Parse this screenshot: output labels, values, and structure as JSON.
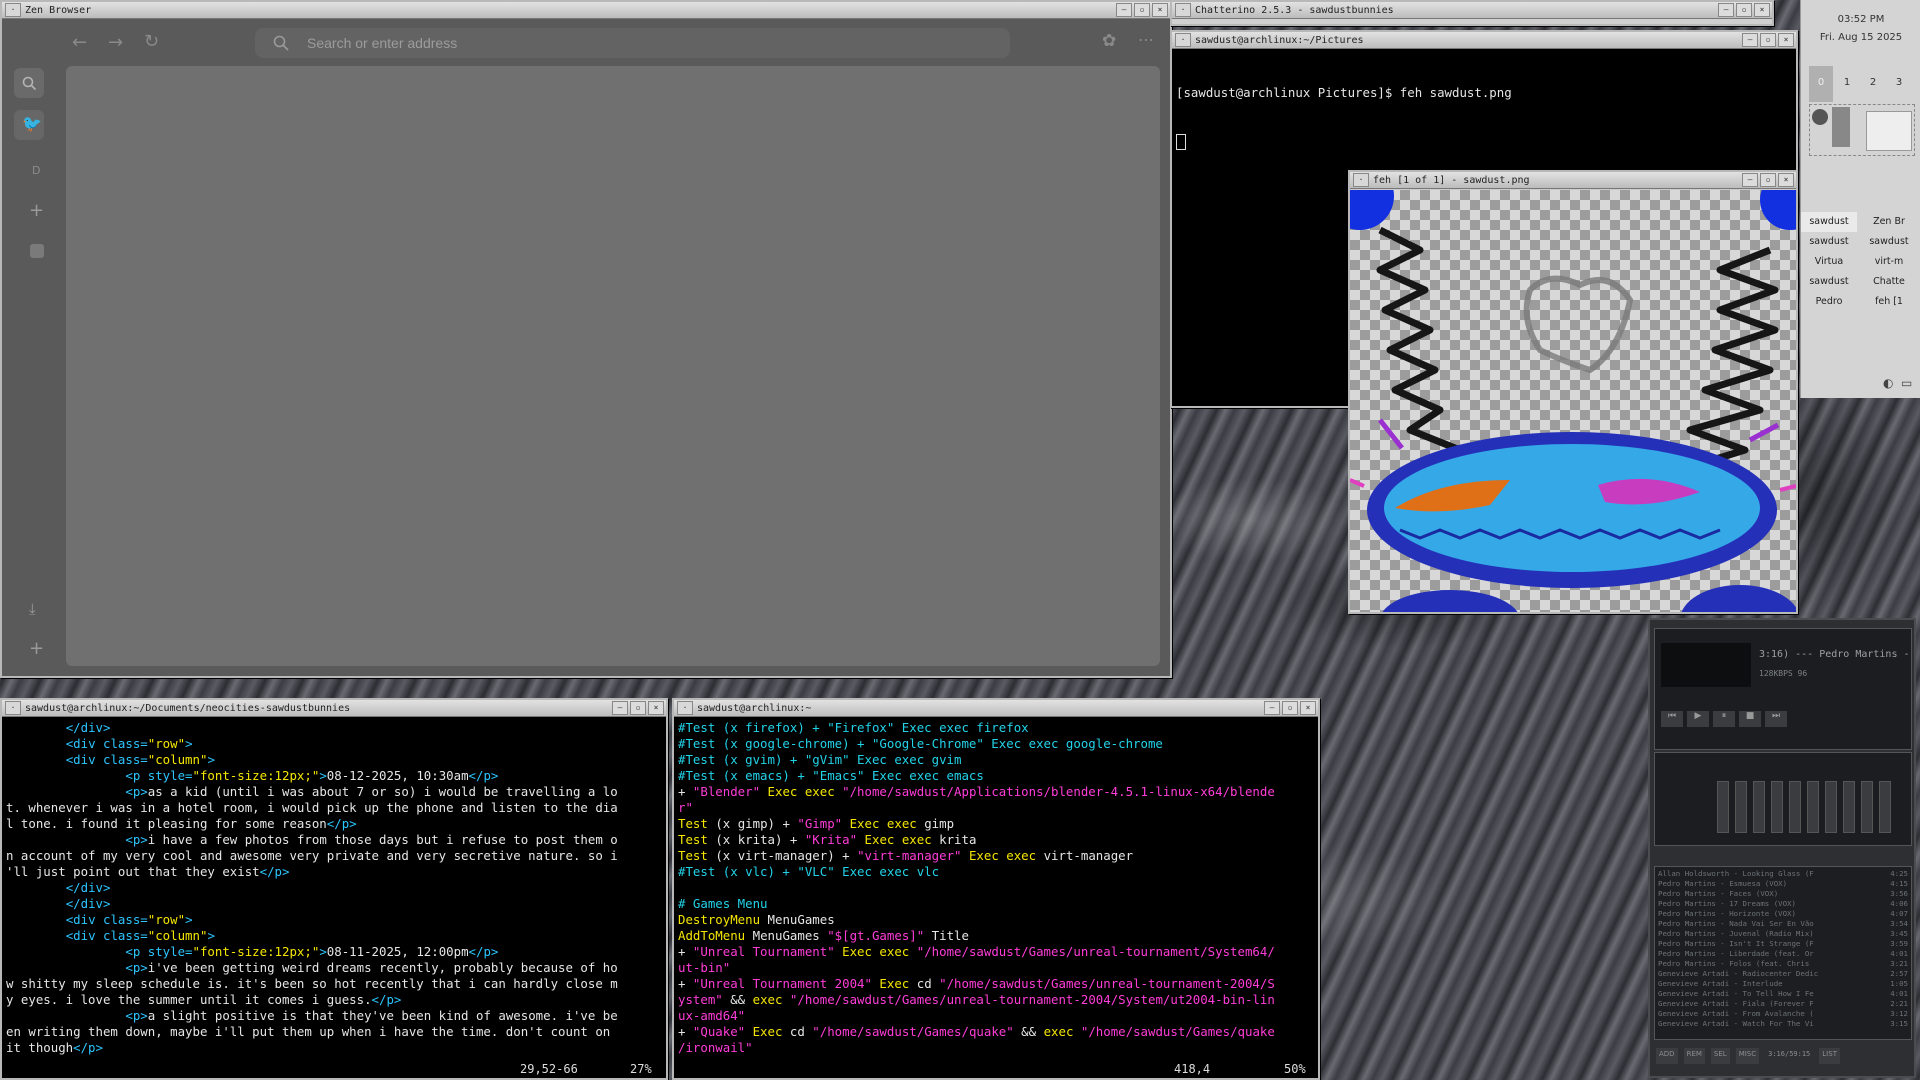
{
  "browser": {
    "title": "Zen Browser",
    "url_placeholder": "Search or enter address",
    "sidebar_letter": "D"
  },
  "chatterino": {
    "title": "Chatterino 2.5.3 - sawdustbunnies"
  },
  "term_top": {
    "title": "sawdust@archlinux:~/Pictures",
    "prompt": "[sawdust@archlinux Pictures]$ feh sawdust.png"
  },
  "feh": {
    "title": "feh [1 of 1] - sawdust.png"
  },
  "clock": {
    "time": "03:52 PM",
    "date": "Fri. Aug 15 2025"
  },
  "pager": {
    "workspaces": [
      "0",
      "1",
      "2",
      "3"
    ]
  },
  "tasklist": [
    {
      "a": "sawdust",
      "b": "Zen Br"
    },
    {
      "a": "sawdust",
      "b": "sawdust"
    },
    {
      "a": "Virtua",
      "b": "virt-m"
    },
    {
      "a": "sawdust",
      "b": "Chatte"
    },
    {
      "a": "Pedro",
      "b": "feh [1"
    }
  ],
  "vim_left": {
    "title": "sawdust@archlinux:~/Documents/neocities-sawdustbunnies",
    "lines": [
      {
        "i": "        ",
        "t": [
          [
            "b",
            "</div>"
          ]
        ]
      },
      {
        "i": "        ",
        "t": [
          [
            "b",
            "<div class="
          ],
          [
            "y",
            "\"row\""
          ],
          [
            "b",
            ">"
          ]
        ]
      },
      {
        "i": "        ",
        "t": [
          [
            "b",
            "<div class="
          ],
          [
            "y",
            "\"column\""
          ],
          [
            "b",
            ">"
          ]
        ]
      },
      {
        "i": "                ",
        "t": [
          [
            "b",
            "<p style="
          ],
          [
            "y",
            "\"font-size:12px;\""
          ],
          [
            "b",
            ">"
          ],
          [
            "w",
            "08-12-2025, 10:30am"
          ],
          [
            "b",
            "</p>"
          ]
        ]
      },
      {
        "i": "                ",
        "t": [
          [
            "b",
            "<p>"
          ],
          [
            "w",
            "as a kid (until i was about 7 or so) i would be travelling a lo"
          ]
        ]
      },
      {
        "i": "",
        "t": [
          [
            "w",
            "t. whenever i was in a hotel room, i would pick up the phone and listen to the dia"
          ]
        ]
      },
      {
        "i": "",
        "t": [
          [
            "w",
            "l tone. i found it pleasing for some reason"
          ],
          [
            "b",
            "</p>"
          ]
        ]
      },
      {
        "i": "                ",
        "t": [
          [
            "b",
            "<p>"
          ],
          [
            "w",
            "i have a few photos from those days but i refuse to post them o"
          ]
        ]
      },
      {
        "i": "",
        "t": [
          [
            "w",
            "n account of my very cool and awesome very private and very secretive nature. so i"
          ]
        ]
      },
      {
        "i": "",
        "t": [
          [
            "w",
            "'ll just point out that they exist"
          ],
          [
            "b",
            "</p>"
          ]
        ]
      },
      {
        "i": "        ",
        "t": [
          [
            "b",
            "</div>"
          ]
        ]
      },
      {
        "i": "        ",
        "t": [
          [
            "b",
            "</div>"
          ]
        ]
      },
      {
        "i": "        ",
        "t": [
          [
            "b",
            "<div class="
          ],
          [
            "y",
            "\"row\""
          ],
          [
            "b",
            ">"
          ]
        ]
      },
      {
        "i": "        ",
        "t": [
          [
            "b",
            "<div class="
          ],
          [
            "y",
            "\"column\""
          ],
          [
            "b",
            ">"
          ]
        ]
      },
      {
        "i": "                ",
        "t": [
          [
            "b",
            "<p style="
          ],
          [
            "y",
            "\"font-size:12px;\""
          ],
          [
            "b",
            ">"
          ],
          [
            "w",
            "08-11-2025, 12:00pm"
          ],
          [
            "b",
            "</p>"
          ]
        ]
      },
      {
        "i": "                ",
        "t": [
          [
            "b",
            "<p>"
          ],
          [
            "w",
            "i've been getting weird dreams recently, probably because of ho"
          ]
        ]
      },
      {
        "i": "",
        "t": [
          [
            "w",
            "w shitty my sleep schedule is. it's been so hot recently that i can hardly close m"
          ]
        ]
      },
      {
        "i": "",
        "t": [
          [
            "w",
            "y eyes. i love the summer until it comes i guess."
          ],
          [
            "b",
            "</p>"
          ]
        ]
      },
      {
        "i": "                ",
        "t": [
          [
            "b",
            "<p>"
          ],
          [
            "w",
            "a slight positive is that they've been kind of awesome. i've be"
          ]
        ]
      },
      {
        "i": "",
        "t": [
          [
            "w",
            "en writing them down, maybe i'll put them up when i have the time. don't count on"
          ]
        ]
      },
      {
        "i": "",
        "t": [
          [
            "w",
            "it though"
          ],
          [
            "b",
            "</p>"
          ]
        ]
      }
    ],
    "pos": "29,52-66",
    "pct": "27%"
  },
  "vim_right": {
    "title": "sawdust@archlinux:~",
    "lines": [
      {
        "t": [
          [
            "c",
            "#Test (x firefox) + \"Firefox\" Exec exec firefox"
          ]
        ]
      },
      {
        "t": [
          [
            "c",
            "#Test (x google-chrome) + \"Google-Chrome\" Exec exec google-chrome"
          ]
        ]
      },
      {
        "t": [
          [
            "c",
            "#Test (x gvim) + \"gVim\" Exec exec gvim"
          ]
        ]
      },
      {
        "t": [
          [
            "c",
            "#Test (x emacs) + \"Emacs\" Exec exec emacs"
          ]
        ]
      },
      {
        "t": [
          [
            "w",
            "+ "
          ],
          [
            "m",
            "\"Blender\""
          ],
          [
            "y",
            " Exec exec "
          ],
          [
            "m",
            "\"/home/sawdust/Applications/blender-4.5.1-linux-x64/blende"
          ]
        ]
      },
      {
        "t": [
          [
            "m",
            "r\""
          ]
        ]
      },
      {
        "t": [
          [
            "y",
            "Test "
          ],
          [
            "w",
            "(x gimp) + "
          ],
          [
            "m",
            "\"Gimp\""
          ],
          [
            "y",
            " Exec exec "
          ],
          [
            "w",
            "gimp"
          ]
        ]
      },
      {
        "t": [
          [
            "y",
            "Test "
          ],
          [
            "w",
            "(x krita) + "
          ],
          [
            "m",
            "\"Krita\""
          ],
          [
            "y",
            " Exec exec "
          ],
          [
            "w",
            "krita"
          ]
        ]
      },
      {
        "t": [
          [
            "y",
            "Test "
          ],
          [
            "w",
            "(x virt-manager) + "
          ],
          [
            "m",
            "\"virt-manager\""
          ],
          [
            "y",
            " Exec exec "
          ],
          [
            "w",
            "virt-manager"
          ]
        ]
      },
      {
        "t": [
          [
            "c",
            "#Test (x vlc) + \"VLC\" Exec exec vlc"
          ]
        ]
      },
      {
        "t": [
          [
            "w",
            ""
          ]
        ]
      },
      {
        "t": [
          [
            "c",
            "# Games Menu"
          ]
        ]
      },
      {
        "t": [
          [
            "y",
            "DestroyMenu "
          ],
          [
            "w",
            "MenuGames"
          ]
        ]
      },
      {
        "t": [
          [
            "y",
            "AddToMenu "
          ],
          [
            "w",
            "MenuGames "
          ],
          [
            "m",
            "\"$[gt.Games]\""
          ],
          [
            "w",
            " Title"
          ]
        ]
      },
      {
        "t": [
          [
            "w",
            "+ "
          ],
          [
            "m",
            "\"Unreal Tournament\""
          ],
          [
            "y",
            " Exec exec "
          ],
          [
            "m",
            "\"/home/sawdust/Games/unreal-tournament/System64/"
          ]
        ]
      },
      {
        "t": [
          [
            "m",
            "ut-bin\""
          ]
        ]
      },
      {
        "t": [
          [
            "w",
            "+ "
          ],
          [
            "m",
            "\"Unreal Tournament 2004\""
          ],
          [
            "y",
            " Exec "
          ],
          [
            "w",
            "cd "
          ],
          [
            "m",
            "\"/home/sawdust/Games/unreal-tournament-2004/S"
          ]
        ]
      },
      {
        "t": [
          [
            "m",
            "ystem\""
          ],
          [
            "w",
            " && "
          ],
          [
            "y",
            "exec "
          ],
          [
            "m",
            "\"/home/sawdust/Games/unreal-tournament-2004/System/ut2004-bin-lin"
          ]
        ]
      },
      {
        "t": [
          [
            "m",
            "ux-amd64\""
          ]
        ]
      },
      {
        "t": [
          [
            "w",
            "+ "
          ],
          [
            "m",
            "\"Quake\""
          ],
          [
            "y",
            " Exec "
          ],
          [
            "w",
            "cd "
          ],
          [
            "m",
            "\"/home/sawdust/Games/quake\""
          ],
          [
            "w",
            " && "
          ],
          [
            "y",
            "exec "
          ],
          [
            "m",
            "\"/home/sawdust/Games/quake"
          ]
        ]
      },
      {
        "t": [
          [
            "m",
            "/ironwail\""
          ]
        ]
      }
    ],
    "pos": "418,4",
    "pct": "50%"
  },
  "winamp": {
    "track": "3:16) --- Pedro Martins -",
    "bitrate": "128KBPS 96",
    "playlist": [
      {
        "title": "Allan Holdsworth - Looking Glass (F",
        "len": "4:25"
      },
      {
        "title": "Pedro Martins - Esmuesa (VOX)",
        "len": "4:15"
      },
      {
        "title": "Pedro Martins - Faces (VOX)",
        "len": "3:56"
      },
      {
        "title": "Pedro Martins - 17 Dreams (VOX)",
        "len": "4:06"
      },
      {
        "title": "Pedro Martins - Horizonte (VOX)",
        "len": "4:07"
      },
      {
        "title": "Pedro Martins - Nada Vai Ser En Vão",
        "len": "3:54"
      },
      {
        "title": "Pedro Martins - Juvenal (Radio Mix)",
        "len": "3:45"
      },
      {
        "title": "Pedro Martins - Isn't It Strange (F",
        "len": "3:59"
      },
      {
        "title": "Pedro Martins - Liberdade (feat. Or",
        "len": "4:01"
      },
      {
        "title": "Pedro Martins - Folos (feat. Chris",
        "len": "3:21"
      },
      {
        "title": "Genevieve Artadi - Radiocenter Dedic",
        "len": "2:57"
      },
      {
        "title": "Genevieve Artadi - Interlude",
        "len": "1:05"
      },
      {
        "title": "Genevieve Artadi - To Tell How I Fe",
        "len": "4:01"
      },
      {
        "title": "Genevieve Artadi - Fiala (Forever F",
        "len": "2:21"
      },
      {
        "title": "Genevieve Artadi - From Avalanche (",
        "len": "3:12"
      },
      {
        "title": "Genevieve Artadi - Watch For The Vi",
        "len": "3:15"
      }
    ],
    "buttons": [
      "ADD",
      "REM",
      "SEL",
      "MISC",
      "LIST"
    ],
    "total": "3:16/59:15"
  }
}
